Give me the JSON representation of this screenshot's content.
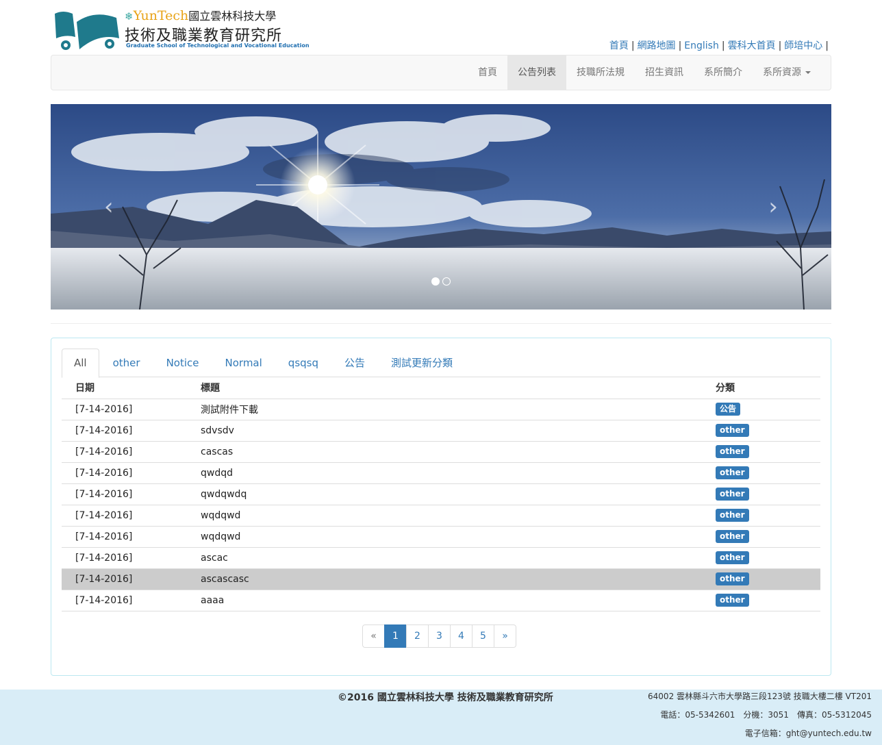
{
  "header": {
    "logo_brand_1": "YunTech",
    "logo_university": "國立雲林科技大學",
    "logo_title": "技術及職業教育研究所",
    "logo_english": "Graduate School of Technological and Vocational Education",
    "top_links": [
      "首頁",
      "網路地圖",
      "English",
      "雲科大首頁",
      "師培中心"
    ]
  },
  "nav": {
    "items": [
      "首頁",
      "公告列表",
      "技職所法規",
      "招生資訊",
      "系所簡介",
      "系所資源"
    ],
    "active": "公告列表"
  },
  "carousel": {
    "prev_icon": "chevron-left-icon",
    "next_icon": "chevron-right-icon",
    "prev_glyph": "‹",
    "next_glyph": "›",
    "slide_count": 2,
    "active_slide": 1
  },
  "tabs": {
    "items": [
      "All",
      "other",
      "Notice",
      "Normal",
      "qsqsq",
      "公告",
      "測試更新分類"
    ],
    "active": "All"
  },
  "table": {
    "headers": [
      "日期",
      "標題",
      "分類"
    ],
    "rows": [
      {
        "date": "[7-14-2016]",
        "title": "測試附件下載",
        "category": "公告"
      },
      {
        "date": "[7-14-2016]",
        "title": "sdvsdv",
        "category": "other"
      },
      {
        "date": "[7-14-2016]",
        "title": "cascas",
        "category": "other"
      },
      {
        "date": "[7-14-2016]",
        "title": "qwdqd",
        "category": "other"
      },
      {
        "date": "[7-14-2016]",
        "title": "qwdqwdq",
        "category": "other"
      },
      {
        "date": "[7-14-2016]",
        "title": "wqdqwd",
        "category": "other"
      },
      {
        "date": "[7-14-2016]",
        "title": "wqdqwd",
        "category": "other"
      },
      {
        "date": "[7-14-2016]",
        "title": "ascac",
        "category": "other"
      },
      {
        "date": "[7-14-2016]",
        "title": "ascascasc",
        "category": "other"
      },
      {
        "date": "[7-14-2016]",
        "title": "aaaa",
        "category": "other"
      }
    ],
    "highlighted_row": 8
  },
  "pagination": {
    "prev": "«",
    "pages": [
      "1",
      "2",
      "3",
      "4",
      "5"
    ],
    "next": "»",
    "current": "1"
  },
  "footer": {
    "copyright": "©2016 國立雲林科技大學 技術及職業教育研究所",
    "address": "64002 雲林縣斗六市大學路三段123號 技職大樓二樓 VT201",
    "phone": "電話：05-5342601　分機：3051　傳真：05-5312045",
    "email": "電子信箱：ght@yuntech.edu.tw"
  },
  "colors": {
    "link": "#337ab7",
    "label_bg": "#337ab7",
    "footer_bg": "#d9edf7",
    "panel_border": "#bce8f1",
    "row_highlight": "#cccccc"
  }
}
